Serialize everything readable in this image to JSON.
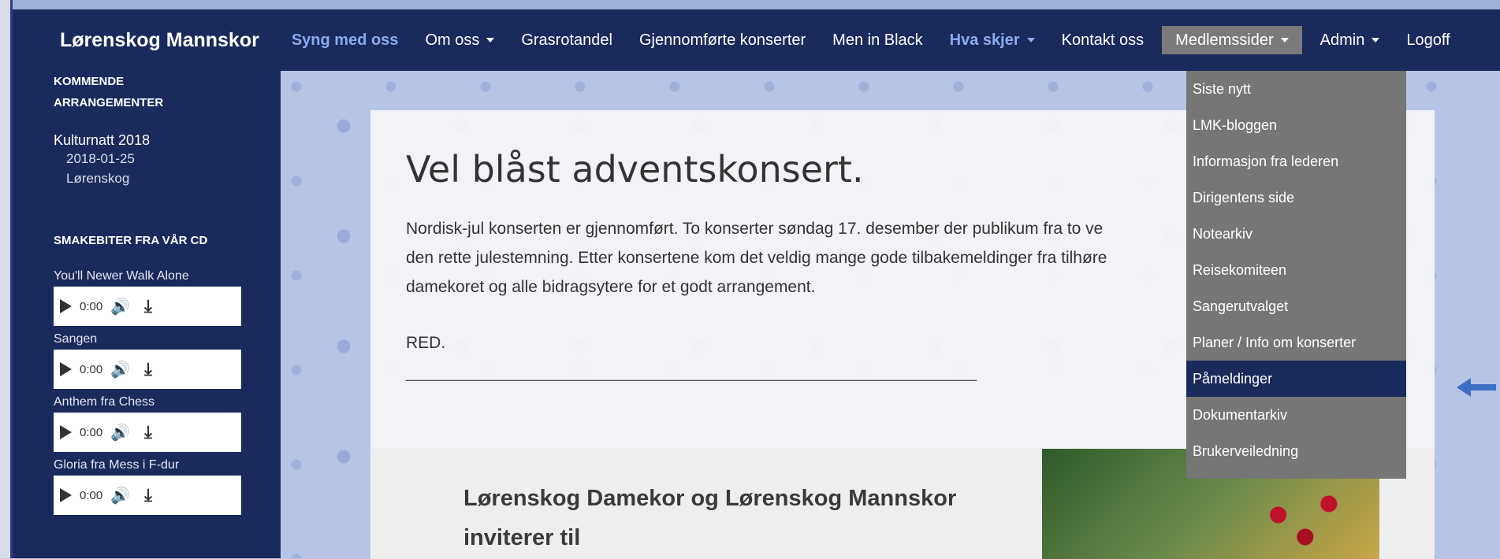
{
  "brand": "Lørenskog Mannskor",
  "nav": [
    {
      "label": "Syng med oss",
      "highlight": true,
      "caret": false
    },
    {
      "label": "Om oss",
      "highlight": false,
      "caret": true
    },
    {
      "label": "Grasrotandel",
      "highlight": false,
      "caret": false
    },
    {
      "label": "Gjennomførte konserter",
      "highlight": false,
      "caret": false
    },
    {
      "label": "Men in Black",
      "highlight": false,
      "caret": false
    },
    {
      "label": "Hva skjer",
      "highlight": true,
      "caret": true
    },
    {
      "label": "Kontakt oss",
      "highlight": false,
      "caret": false
    },
    {
      "label": "Medlemssider",
      "highlight": false,
      "caret": true,
      "open": true
    },
    {
      "label": "Admin",
      "highlight": false,
      "caret": true
    },
    {
      "label": "Logoff",
      "highlight": false,
      "caret": false
    }
  ],
  "sidebar": {
    "events_heading": "KOMMENDE ARRANGEMENTER",
    "event": {
      "title": "Kulturnatt 2018",
      "date": "2018-01-25",
      "place": "Lørenskog"
    },
    "cd_heading": "SMAKEBITER FRA VÅR CD",
    "tracks": [
      {
        "title": "You'll Newer Walk Alone",
        "time": "0:00"
      },
      {
        "title": "Sangen",
        "time": "0:00"
      },
      {
        "title": "Anthem fra Chess",
        "time": "0:00"
      },
      {
        "title": "Gloria fra Mess i F-dur",
        "time": "0:00"
      }
    ]
  },
  "article": {
    "title": "Vel blåst adventskonsert.",
    "paragraph_lines": [
      "Nordisk-jul konserten er gjennomført. To konserter søndag 17. desember der publikum fra to ve",
      "den rette julestemning. Etter konsertene kom det veldig mange gode tilbakemeldinger fra tilhøre",
      "damekoret og alle bidragsytere for et godt arrangement."
    ],
    "signature": "RED.",
    "rule": "______________________________________________________________",
    "poster_line1": "Lørenskog Damekor og Lørenskog Mannskor",
    "poster_line2": "inviterer til"
  },
  "dropdown": {
    "items": [
      {
        "label": "Siste nytt"
      },
      {
        "label": "LMK-bloggen"
      },
      {
        "label": "Informasjon fra lederen"
      },
      {
        "label": "Dirigentens side"
      },
      {
        "label": "Notearkiv"
      },
      {
        "label": "Reisekomiteen"
      },
      {
        "label": "Sangerutvalget"
      },
      {
        "label": "Planer / Info om konserter"
      },
      {
        "label": "Påmeldinger",
        "active": true
      },
      {
        "label": "Dokumentarkiv"
      },
      {
        "label": "Brukerveiledning"
      }
    ]
  },
  "colors": {
    "navbar": "#1b2a5c",
    "highlight": "#8ea9f0",
    "dropdown": "#767676",
    "arrow": "#3e6fc6"
  }
}
